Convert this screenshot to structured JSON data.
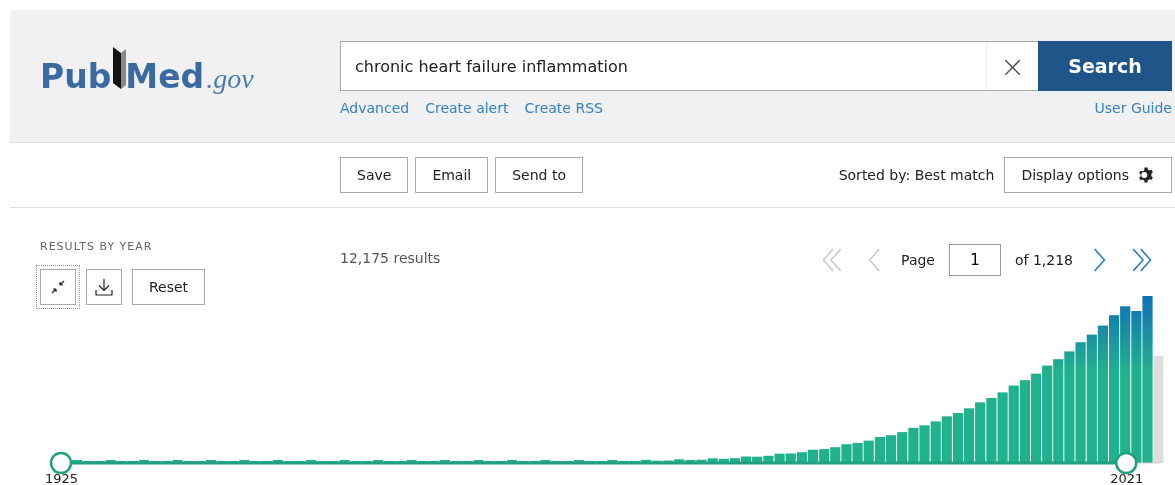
{
  "logo": {
    "part_1": "Pub",
    "part_2": "Med",
    "suffix": ".gov"
  },
  "search": {
    "value": "chronic heart failure inflammation",
    "clear": "×",
    "button": "Search"
  },
  "search_links": [
    "Advanced",
    "Create alert",
    "Create RSS"
  ],
  "user_guide": "User Guide",
  "actions": [
    "Save",
    "Email",
    "Send to"
  ],
  "sort": "Sorted by: Best match",
  "display_options": "Display options",
  "timeline": {
    "title": "RESULTS BY YEAR",
    "reset": "Reset",
    "handles": [
      {
        "label": "1925",
        "level": 0
      },
      {
        "label": "2021",
        "level": 0.99
      }
    ]
  },
  "results_count": "12,175 results",
  "pagination": {
    "page_label": "Page",
    "page": "1",
    "of": "of 1,218",
    "first_disabled": true,
    "previous_disabled": true,
    "next_disabled": false,
    "last_disabled": false
  }
}
